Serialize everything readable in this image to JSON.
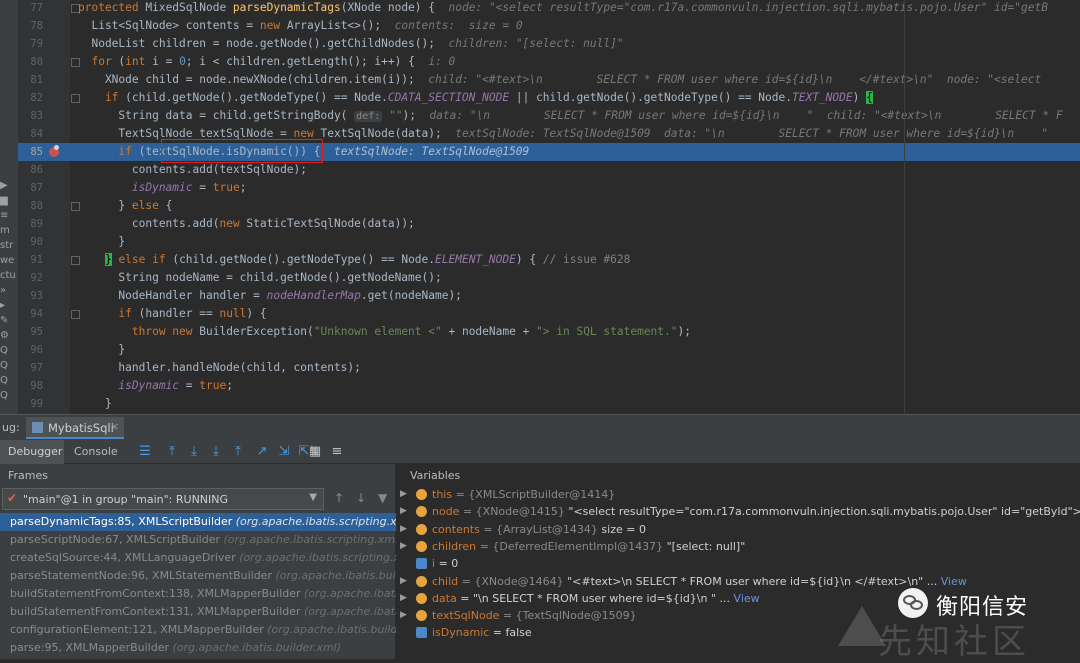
{
  "left_strip": [
    "▶",
    "▆",
    "≡",
    "m",
    "str",
    "we",
    "ctu",
    "»",
    "▸",
    "✎",
    "⚙",
    "Q",
    "Q",
    "Q",
    "Q"
  ],
  "code": {
    "lines": [
      {
        "num": "77",
        "segs": [
          [
            "kw",
            "protected "
          ],
          [
            "tx",
            "MixedSqlNode "
          ],
          [
            "fn",
            "parseDynamicTags"
          ],
          [
            "tx",
            "(XNode node) {  "
          ],
          [
            "hint",
            "node: \"<select resultType=\"com.r17a.commonvuln.injection.sqli.mybatis.pojo.User\" id=\"getB"
          ]
        ]
      },
      {
        "num": "78",
        "segs": [
          [
            "tx",
            "  List<SqlNode> contents = "
          ],
          [
            "kw",
            "new "
          ],
          [
            "tx",
            "ArrayList<>();  "
          ],
          [
            "hint",
            "contents:  size = 0"
          ]
        ]
      },
      {
        "num": "79",
        "segs": [
          [
            "tx",
            "  NodeList children = node.getNode().getChildNodes();  "
          ],
          [
            "hint",
            "children: \"[select: null]\""
          ]
        ]
      },
      {
        "num": "80",
        "segs": [
          [
            "kw",
            "  for "
          ],
          [
            "tx",
            "("
          ],
          [
            "kw",
            "int "
          ],
          [
            "tx",
            "i = "
          ],
          [
            "num",
            "0"
          ],
          [
            "tx",
            "; i < children.getLength(); i++) {  "
          ],
          [
            "hint",
            "i: 0"
          ]
        ]
      },
      {
        "num": "81",
        "segs": [
          [
            "tx",
            "    XNode child = node.newXNode(children.item(i));  "
          ],
          [
            "hint",
            "child: \"<#text>\\n        SELECT * FROM user where id=${id}\\n    </#text>\\n\"  node: \"<select"
          ]
        ]
      },
      {
        "num": "82",
        "segs": [
          [
            "kw",
            "    if "
          ],
          [
            "tx",
            "(child.getNode().getNodeType() == Node."
          ],
          [
            "fd",
            "CDATA_SECTION_NODE"
          ],
          [
            "tx",
            " || child.getNode().getNodeType() == Node."
          ],
          [
            "fd",
            "TEXT_NODE"
          ],
          [
            "tx",
            ") "
          ],
          [
            "brace2",
            "{"
          ]
        ]
      },
      {
        "num": "83",
        "segs": [
          [
            "tx",
            "      String data = child.getStringBody( "
          ],
          [
            "pill",
            "def:"
          ],
          [
            "st",
            " \"\""
          ],
          [
            "tx",
            ");  "
          ],
          [
            "hint",
            "data: \"\\n        SELECT * FROM user where id=${id}\\n    \"  child: \"<#text>\\n        SELECT * F"
          ]
        ]
      },
      {
        "num": "84",
        "segs": [
          [
            "tx",
            "      TextSqlNode textSqlNode = "
          ],
          [
            "kw",
            "new "
          ],
          [
            "tx",
            "TextSqlNode(data);  "
          ],
          [
            "hint",
            "textSqlNode: TextSqlNode@1509  data: \"\\n        SELECT * FROM user where id=${id}\\n    \""
          ]
        ]
      },
      {
        "num": "85",
        "segs": [
          [
            "kw",
            "      if "
          ],
          [
            "tx",
            "(textSqlNode.isDynamic()) {  "
          ],
          [
            "hint",
            "textSqlNode: TextSqlNode@1509"
          ]
        ]
      },
      {
        "num": "86",
        "segs": [
          [
            "tx",
            "        contents.add(textSqlNode);"
          ]
        ]
      },
      {
        "num": "87",
        "segs": [
          [
            "fd",
            "        isDynamic"
          ],
          [
            "tx",
            " = "
          ],
          [
            "kw",
            "true"
          ],
          [
            "tx",
            ";"
          ]
        ]
      },
      {
        "num": "88",
        "segs": [
          [
            "tx",
            "      } "
          ],
          [
            "kw",
            "else "
          ],
          [
            "tx",
            "{"
          ]
        ]
      },
      {
        "num": "89",
        "segs": [
          [
            "tx",
            "        contents.add("
          ],
          [
            "kw",
            "new "
          ],
          [
            "tx",
            "StaticTextSqlNode(data));"
          ]
        ]
      },
      {
        "num": "90",
        "segs": [
          [
            "tx",
            "      }"
          ]
        ]
      },
      {
        "num": "91",
        "segs": [
          [
            "tx",
            "    "
          ],
          [
            "brace2",
            "}"
          ],
          [
            "kw",
            " else if "
          ],
          [
            "tx",
            "(child.getNode().getNodeType() == Node."
          ],
          [
            "fd",
            "ELEMENT_NODE"
          ],
          [
            "tx",
            ") { "
          ],
          [
            "cm",
            "// issue #628"
          ]
        ]
      },
      {
        "num": "92",
        "segs": [
          [
            "tx",
            "      String nodeName = child.getNode().getNodeName();"
          ]
        ]
      },
      {
        "num": "93",
        "segs": [
          [
            "tx",
            "      NodeHandler handler = "
          ],
          [
            "fd",
            "nodeHandlerMap"
          ],
          [
            "tx",
            ".get(nodeName);"
          ]
        ]
      },
      {
        "num": "94",
        "segs": [
          [
            "kw",
            "      if "
          ],
          [
            "tx",
            "(handler == "
          ],
          [
            "kw",
            "null"
          ],
          [
            "tx",
            ") {"
          ]
        ]
      },
      {
        "num": "95",
        "segs": [
          [
            "kw",
            "        throw new "
          ],
          [
            "tx",
            "BuilderException("
          ],
          [
            "st",
            "\"Unknown element <\""
          ],
          [
            "tx",
            " + nodeName + "
          ],
          [
            "st",
            "\"> in SQL statement.\""
          ],
          [
            "tx",
            ");"
          ]
        ]
      },
      {
        "num": "96",
        "segs": [
          [
            "tx",
            "      }"
          ]
        ]
      },
      {
        "num": "97",
        "segs": [
          [
            "tx",
            "      handler.handleNode(child, contents);"
          ]
        ]
      },
      {
        "num": "98",
        "segs": [
          [
            "fd",
            "      isDynamic"
          ],
          [
            "tx",
            " = "
          ],
          [
            "kw",
            "true"
          ],
          [
            "tx",
            ";"
          ]
        ]
      },
      {
        "num": "99",
        "segs": [
          [
            "tx",
            "    }"
          ]
        ]
      }
    ]
  },
  "debug": {
    "label": "ug:",
    "tab_title": "MybatisSqli",
    "tab_close": "×",
    "debugger_label": "Debugger",
    "console_label": "Console",
    "toolbar_icons": [
      "☰",
      "⤒",
      "⤓",
      "⤓",
      "⤒",
      "↗",
      "⇲",
      "⇱",
      "↯",
      "▦",
      "≡"
    ],
    "frames_header": "Frames",
    "variables_header": "Variables",
    "thread_text": "\"main\"@1 in group \"main\": RUNNING",
    "frames": [
      {
        "method": "parseDynamicTags:85, XMLScriptBuilder",
        "pkg": "(org.apache.ibatis.scripting.xmltags)"
      },
      {
        "method": "parseScriptNode:67, XMLScriptBuilder",
        "pkg": "(org.apache.ibatis.scripting.xmltags)"
      },
      {
        "method": "createSqlSource:44, XMLLanguageDriver",
        "pkg": "(org.apache.ibatis.scripting.xmltags)"
      },
      {
        "method": "parseStatementNode:96, XMLStatementBuilder",
        "pkg": "(org.apache.ibatis.builder.xml)"
      },
      {
        "method": "buildStatementFromContext:138, XMLMapperBuilder",
        "pkg": "(org.apache.ibatis.builder.xml)"
      },
      {
        "method": "buildStatementFromContext:131, XMLMapperBuilder",
        "pkg": "(org.apache.ibatis.builder.xml)"
      },
      {
        "method": "configurationElement:121, XMLMapperBuilder",
        "pkg": "(org.apache.ibatis.builder.xml)"
      },
      {
        "method": "parse:95, XMLMapperBuilder",
        "pkg": "(org.apache.ibatis.builder.xml)"
      }
    ],
    "variables": [
      {
        "expand": "▶",
        "icon": "#e8a33d",
        "name": "this",
        "id": "{XMLScriptBuilder@1414}",
        "val": "",
        "link": ""
      },
      {
        "expand": "▶",
        "icon": "#e8a33d",
        "name": "node",
        "id": "{XNode@1415}",
        "val": "\"<select resultType=\"com.r17a.commonvuln.injection.sqli.mybatis.pojo.User\" id=\"getById\">\\n        SELECT *",
        "link": ""
      },
      {
        "expand": "▶",
        "icon": "#e8a33d",
        "name": "contents",
        "id": "{ArrayList@1434}",
        "val": "size = 0",
        "link": ""
      },
      {
        "expand": "▶",
        "icon": "#e8a33d",
        "name": "children",
        "id": "{DeferredElementImpl@1437}",
        "val": "\"[select: null]\"",
        "link": ""
      },
      {
        "expand": "",
        "icon": "#4a88c7",
        "name": "i",
        "id": "",
        "val": "= 0",
        "link": ""
      },
      {
        "expand": "▶",
        "icon": "#e8a33d",
        "name": "child",
        "id": "{XNode@1464}",
        "val": "\"<#text>\\n        SELECT * FROM user where id=${id}\\n    </#text>\\n\" ...",
        "link": "View"
      },
      {
        "expand": "▶",
        "icon": "#e8a33d",
        "name": "data",
        "id": "",
        "val": "= \"\\n        SELECT * FROM user where id=${id}\\n    \" ...",
        "link": "View"
      },
      {
        "expand": "▶",
        "icon": "#e8a33d",
        "name": "textSqlNode",
        "id": "{TextSqlNode@1509}",
        "val": "",
        "link": ""
      },
      {
        "expand": "",
        "icon": "#4a88c7",
        "name": "isDynamic",
        "id": "",
        "val": "= false",
        "link": ""
      }
    ]
  },
  "watermark": {
    "name": "衡阳信安",
    "forum": "先知社区"
  },
  "colors": {
    "highlight": "#2d6099",
    "breakpoint": "#c75450",
    "accent": "#4a88c7"
  }
}
